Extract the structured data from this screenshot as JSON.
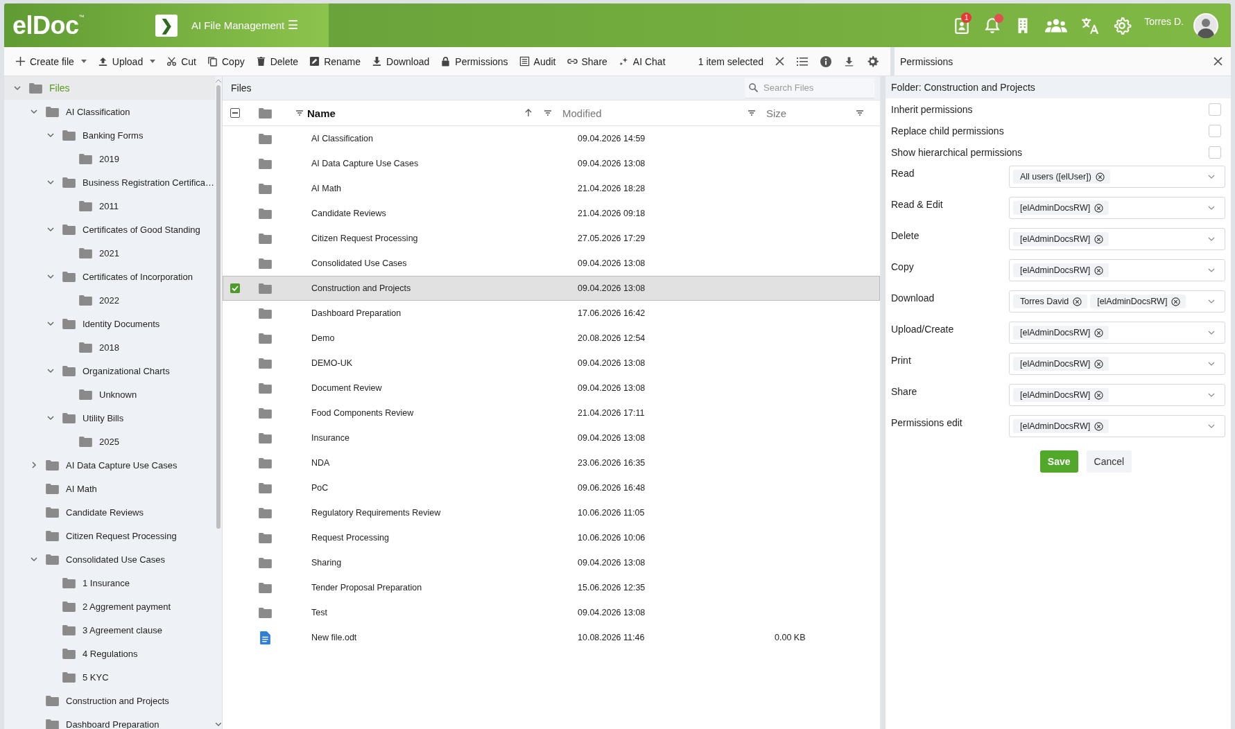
{
  "header": {
    "logo": "elDoc",
    "logo_mark": "™",
    "toggle": "❯",
    "app_title": "AI File Management",
    "menu": "☰",
    "contacts_badge": "1",
    "bell_dot": true,
    "user": "Torres D."
  },
  "toolbar": {
    "actions": [
      {
        "label": "Create file",
        "dropdown": true
      },
      {
        "label": "Upload",
        "dropdown": true
      },
      {
        "label": "Cut",
        "dropdown": false
      },
      {
        "label": "Copy",
        "dropdown": false
      },
      {
        "label": "Delete",
        "dropdown": false
      },
      {
        "label": "Rename",
        "dropdown": false
      },
      {
        "label": "Download",
        "dropdown": false
      },
      {
        "label": "Permissions",
        "dropdown": false
      },
      {
        "label": "Audit",
        "dropdown": false
      },
      {
        "label": "Share",
        "dropdown": false
      },
      {
        "label": "AI Chat",
        "dropdown": false
      }
    ],
    "selection": "1 item selected"
  },
  "tree": [
    {
      "label": "Files",
      "selected": true,
      "expanded": true,
      "children": [
        {
          "label": "AI Classification",
          "selected": false,
          "expanded": true,
          "children": [
            {
              "label": "Banking Forms",
              "selected": false,
              "expanded": true,
              "children": [
                {
                  "label": "2019",
                  "selected": false
                }
              ]
            },
            {
              "label": "Business Registration Certifica…",
              "selected": false,
              "expanded": true,
              "children": [
                {
                  "label": "2011",
                  "selected": false
                }
              ]
            },
            {
              "label": "Certificates of Good Standing",
              "selected": false,
              "expanded": true,
              "children": [
                {
                  "label": "2021",
                  "selected": false
                }
              ]
            },
            {
              "label": "Certificates of Incorporation",
              "selected": false,
              "expanded": true,
              "children": [
                {
                  "label": "2022",
                  "selected": false
                }
              ]
            },
            {
              "label": "Identity Documents",
              "selected": false,
              "expanded": true,
              "children": [
                {
                  "label": "2018",
                  "selected": false
                }
              ]
            },
            {
              "label": "Organizational Charts",
              "selected": false,
              "expanded": true,
              "children": [
                {
                  "label": "Unknown",
                  "selected": false
                }
              ]
            },
            {
              "label": "Utility Bills",
              "selected": false,
              "expanded": true,
              "children": [
                {
                  "label": "2025",
                  "selected": false
                }
              ]
            }
          ]
        },
        {
          "label": "AI Data Capture Use Cases",
          "selected": false,
          "expanded": false
        },
        {
          "label": "AI Math",
          "selected": false
        },
        {
          "label": "Candidate Reviews",
          "selected": false
        },
        {
          "label": "Citizen Request Processing",
          "selected": false
        },
        {
          "label": "Consolidated Use Cases",
          "selected": false,
          "expanded": true,
          "children": [
            {
              "label": "1 Insurance",
              "selected": false
            },
            {
              "label": "2 Aggrement payment",
              "selected": false
            },
            {
              "label": "3 Agreement clause",
              "selected": false
            },
            {
              "label": "4 Regulations",
              "selected": false
            },
            {
              "label": "5 KYC",
              "selected": false
            }
          ]
        },
        {
          "label": "Construction and Projects",
          "selected": false
        },
        {
          "label": "Dashboard Preparation",
          "selected": false
        }
      ]
    }
  ],
  "files": {
    "title": "Files",
    "search": {
      "placeholder": "Search Files"
    },
    "select_all_partial": true,
    "columns": [
      {
        "label": "Name",
        "sorted": true
      },
      {
        "label": "Modified",
        "sorted": false
      },
      {
        "label": "Size",
        "sorted": false
      }
    ],
    "rows": [
      {
        "kind": "folder",
        "name": "AI Classification",
        "modified": "09.04.2026 14:59",
        "selected": false
      },
      {
        "kind": "folder",
        "name": "AI Data Capture Use Cases",
        "modified": "09.04.2026 13:08",
        "selected": false
      },
      {
        "kind": "folder",
        "name": "AI Math",
        "modified": "21.04.2026 18:28",
        "selected": false
      },
      {
        "kind": "folder",
        "name": "Candidate Reviews",
        "modified": "21.04.2026 09:18",
        "selected": false
      },
      {
        "kind": "folder",
        "name": "Citizen Request Processing",
        "modified": "27.05.2026 17:29",
        "selected": false
      },
      {
        "kind": "folder",
        "name": "Consolidated Use Cases",
        "modified": "09.04.2026 13:08",
        "selected": false
      },
      {
        "kind": "folder",
        "name": "Construction and Projects",
        "modified": "09.04.2026 13:08",
        "selected": true
      },
      {
        "kind": "folder",
        "name": "Dashboard Preparation",
        "modified": "17.06.2026 16:42",
        "selected": false
      },
      {
        "kind": "folder",
        "name": "Demo",
        "modified": "20.08.2026 12:54",
        "selected": false
      },
      {
        "kind": "folder",
        "name": "DEMO-UK",
        "modified": "09.04.2026 13:08",
        "selected": false
      },
      {
        "kind": "folder",
        "name": "Document Review",
        "modified": "09.04.2026 13:08",
        "selected": false
      },
      {
        "kind": "folder",
        "name": "Food Components Review",
        "modified": "21.04.2026 17:11",
        "selected": false
      },
      {
        "kind": "folder",
        "name": "Insurance",
        "modified": "09.04.2026 13:08",
        "selected": false
      },
      {
        "kind": "folder",
        "name": "NDA",
        "modified": "23.06.2026 16:35",
        "selected": false
      },
      {
        "kind": "folder",
        "name": "PoC",
        "modified": "09.06.2026 16:48",
        "selected": false
      },
      {
        "kind": "folder",
        "name": "Regulatory Requirements Review",
        "modified": "10.06.2026 11:05",
        "selected": false
      },
      {
        "kind": "folder",
        "name": "Request Processing",
        "modified": "10.06.2026 10:06",
        "selected": false
      },
      {
        "kind": "folder",
        "name": "Sharing",
        "modified": "09.04.2026 13:08",
        "selected": false
      },
      {
        "kind": "folder",
        "name": "Tender Proposal Preparation",
        "modified": "15.06.2026 12:35",
        "selected": false
      },
      {
        "kind": "folder",
        "name": "Test",
        "modified": "09.04.2026 13:08",
        "selected": false
      },
      {
        "kind": "file",
        "name": "New file.odt",
        "modified": "10.08.2026 11:46",
        "size": "0.00 KB",
        "selected": false
      }
    ]
  },
  "permissions": {
    "title": "Permissions",
    "folder": "Folder: Construction and Projects",
    "options": [
      {
        "label": "Inherit permissions",
        "checked": false
      },
      {
        "label": "Replace child permissions",
        "checked": false
      },
      {
        "label": "Show hierarchical permissions",
        "checked": false
      }
    ],
    "fields": [
      {
        "label": "Read",
        "tags": [
          "All users ([elUser])"
        ]
      },
      {
        "label": "Read & Edit",
        "tags": [
          "[elAdminDocsRW]"
        ]
      },
      {
        "label": "Delete",
        "tags": [
          "[elAdminDocsRW]"
        ]
      },
      {
        "label": "Copy",
        "tags": [
          "[elAdminDocsRW]"
        ]
      },
      {
        "label": "Download",
        "tags": [
          "Torres David",
          "[elAdminDocsRW]"
        ]
      },
      {
        "label": "Upload/Create",
        "tags": [
          "[elAdminDocsRW]"
        ]
      },
      {
        "label": "Print",
        "tags": [
          "[elAdminDocsRW]"
        ]
      },
      {
        "label": "Share",
        "tags": [
          "[elAdminDocsRW]"
        ]
      },
      {
        "label": "Permissions edit",
        "tags": [
          "[elAdminDocsRW]"
        ]
      }
    ],
    "buttons": [
      "Save",
      "Cancel"
    ]
  }
}
